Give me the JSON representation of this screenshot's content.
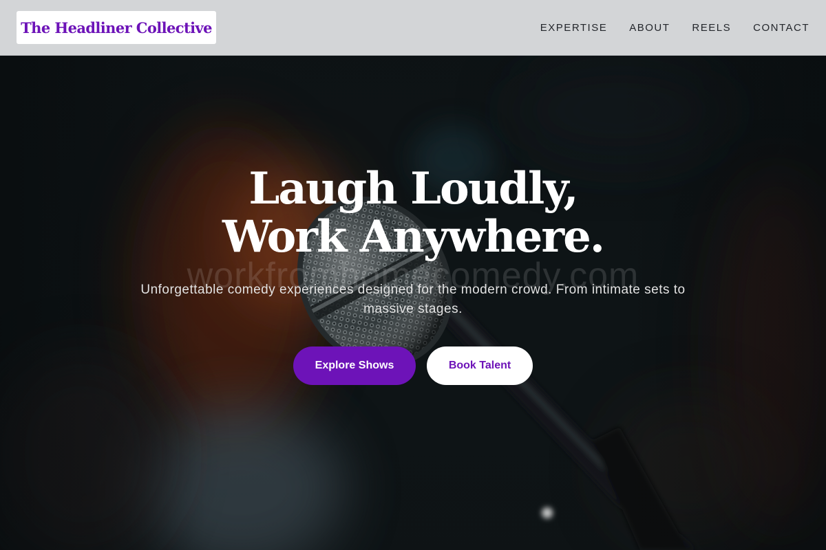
{
  "header": {
    "logo": "The Headliner Collective",
    "nav": [
      "EXPERTISE",
      "ABOUT",
      "REELS",
      "CONTACT"
    ]
  },
  "hero": {
    "title_line1": "Laugh Loudly,",
    "title_line2": "Work Anywhere.",
    "watermark": "workfromhomecomedy.com",
    "subtitle": "Unforgettable comedy experiences designed for the modern crowd. From intimate sets to massive stages.",
    "primary_button": "Explore Shows",
    "secondary_button": "Book Talent",
    "background_image": "microphone-photo"
  },
  "colors": {
    "brand_purple": "#6d13b8",
    "header_bg": "#d3d5d7",
    "hero_bg": "#0d1214",
    "white": "#ffffff"
  }
}
